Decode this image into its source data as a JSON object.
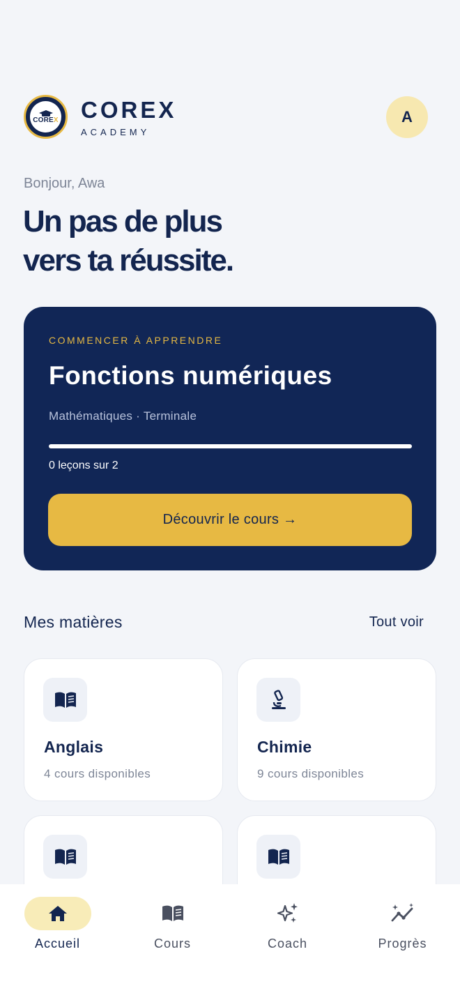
{
  "header": {
    "logo_text": "COREX",
    "brand_name": "COREX",
    "brand_sub": "ACADEMY",
    "avatar_initial": "A"
  },
  "greeting": "Bonjour, Awa",
  "headline": {
    "line1": "Un pas de plus",
    "line2": "vers ta réussite."
  },
  "hero": {
    "eyebrow": "COMMENCER À APPRENDRE",
    "title": "Fonctions numériques",
    "subtitle": "Mathématiques · Terminale",
    "progress_fraction": 0,
    "lessons_text": "0 leçons sur 2",
    "button_label": "Découvrir le cours →"
  },
  "subjects_section": {
    "title": "Mes matières",
    "see_all": "Tout voir",
    "items": [
      {
        "name": "Anglais",
        "count": "4 cours disponibles",
        "icon": "book-icon"
      },
      {
        "name": "Chimie",
        "count": "9 cours disponibles",
        "icon": "microscope-icon"
      },
      {
        "name": "",
        "count": "",
        "icon": "book-icon"
      },
      {
        "name": "",
        "count": "",
        "icon": "book-icon"
      }
    ]
  },
  "nav": {
    "items": [
      {
        "label": "Accueil",
        "icon": "home-icon",
        "active": true
      },
      {
        "label": "Cours",
        "icon": "book-icon",
        "active": false
      },
      {
        "label": "Coach",
        "icon": "sparkles-icon",
        "active": false
      },
      {
        "label": "Progrès",
        "icon": "trend-icon",
        "active": false
      }
    ]
  },
  "colors": {
    "navy": "#112656",
    "gold": "#e7b943",
    "background": "#f3f5f9",
    "active_pill": "#f8ecb8"
  }
}
